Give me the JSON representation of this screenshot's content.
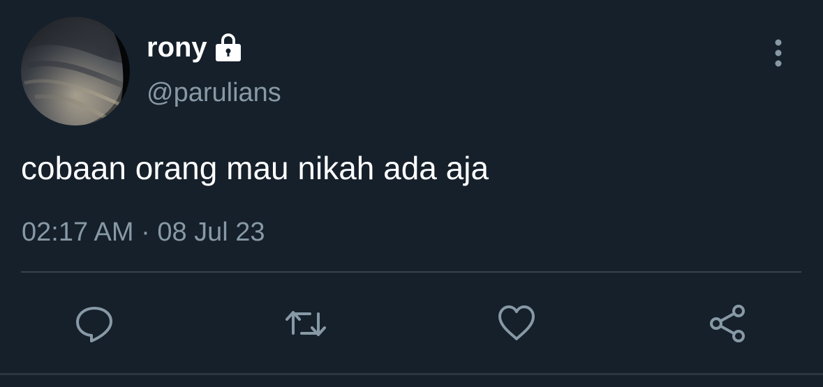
{
  "tweet": {
    "display_name": "rony",
    "handle": "@parulians",
    "text": "cobaan orang mau nikah ada aja",
    "timestamp": "02:17 AM · 08 Jul 23",
    "protected_icon": "lock-icon",
    "menu_icon": "more-vertical-icon"
  },
  "actions": [
    {
      "name": "reply",
      "icon": "reply-icon"
    },
    {
      "name": "retweet",
      "icon": "retweet-icon"
    },
    {
      "name": "like",
      "icon": "heart-icon"
    },
    {
      "name": "share",
      "icon": "share-icon"
    }
  ],
  "colors": {
    "background": "#15202b",
    "primary_text": "#ffffff",
    "secondary_text": "#8899a6",
    "divider": "#38444d"
  }
}
